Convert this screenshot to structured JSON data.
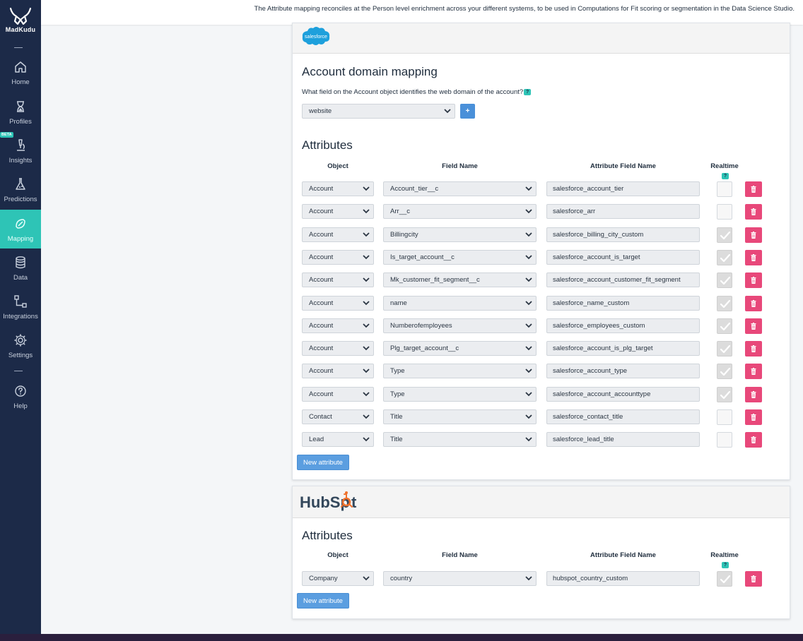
{
  "banner": {
    "text": "The Attribute mapping reconciles at the Person level enrichment across your different systems, to be used in Computations for Fit scoring or segmentation in the Data Science Studio."
  },
  "sidebar": {
    "logo_text": "MadKudu",
    "beta_badge": "BETA",
    "items": [
      {
        "label": "Home",
        "icon": "home-icon"
      },
      {
        "label": "Profiles",
        "icon": "hourglass-icon"
      },
      {
        "label": "Insights",
        "icon": "microscope-icon"
      },
      {
        "label": "Predictions",
        "icon": "flask-icon"
      },
      {
        "label": "Mapping",
        "icon": "mapping-icon",
        "active": true
      },
      {
        "label": "Data",
        "icon": "database-icon"
      },
      {
        "label": "Integrations",
        "icon": "integrations-icon"
      },
      {
        "label": "Settings",
        "icon": "gear-icon"
      },
      {
        "label": "Help",
        "icon": "help-icon"
      }
    ]
  },
  "salesforce": {
    "logo_text": "salesforce",
    "domain_title": "Account domain mapping",
    "domain_question": "What field on the Account object identifies the web domain of the account?",
    "help_badge": "?",
    "domain_field": "website",
    "plus_label": "+",
    "attributes_title": "Attributes",
    "columns": {
      "object": "Object",
      "field": "Field Name",
      "attr": "Attribute Field Name",
      "realtime": "Realtime"
    },
    "rows": [
      {
        "object": "Account",
        "field": "Account_tier__c",
        "attr": "salesforce_account_tier",
        "realtime": false
      },
      {
        "object": "Account",
        "field": "Arr__c",
        "attr": "salesforce_arr",
        "realtime": false
      },
      {
        "object": "Account",
        "field": "Billingcity",
        "attr": "salesforce_billing_city_custom",
        "realtime": true
      },
      {
        "object": "Account",
        "field": "Is_target_account__c",
        "attr": "salesforce_account_is_target",
        "realtime": true
      },
      {
        "object": "Account",
        "field": "Mk_customer_fit_segment__c",
        "attr": "salesforce_account_customer_fit_segment",
        "realtime": true
      },
      {
        "object": "Account",
        "field": "name",
        "attr": "salesforce_name_custom",
        "realtime": true
      },
      {
        "object": "Account",
        "field": "Numberofemployees",
        "attr": "salesforce_employees_custom",
        "realtime": true
      },
      {
        "object": "Account",
        "field": "Plg_target_account__c",
        "attr": "salesforce_account_is_plg_target",
        "realtime": true
      },
      {
        "object": "Account",
        "field": "Type",
        "attr": "salesforce_account_type",
        "realtime": true
      },
      {
        "object": "Account",
        "field": "Type",
        "attr": "salesforce_account_accounttype",
        "realtime": true
      },
      {
        "object": "Contact",
        "field": "Title",
        "attr": "salesforce_contact_title",
        "realtime": false
      },
      {
        "object": "Lead",
        "field": "Title",
        "attr": "salesforce_lead_title",
        "realtime": false
      }
    ],
    "new_attribute_label": "New attribute"
  },
  "hubspot": {
    "logo_text_a": "HubSp",
    "logo_text_b": "t",
    "attributes_title": "Attributes",
    "columns": {
      "object": "Object",
      "field": "Field Name",
      "attr": "Attribute Field Name",
      "realtime": "Realtime"
    },
    "rows": [
      {
        "object": "Company",
        "field": "country",
        "attr": "hubspot_country_custom",
        "realtime": true
      }
    ],
    "new_attribute_label": "New attribute"
  },
  "colors": {
    "sidebar_bg": "#1c2a48",
    "accent_teal": "#2ec4b6",
    "button_blue": "#5b9ee0",
    "delete_pink": "#e8487a",
    "hubspot_orange": "#f0712c",
    "salesforce_blue": "#1ea0dc"
  }
}
